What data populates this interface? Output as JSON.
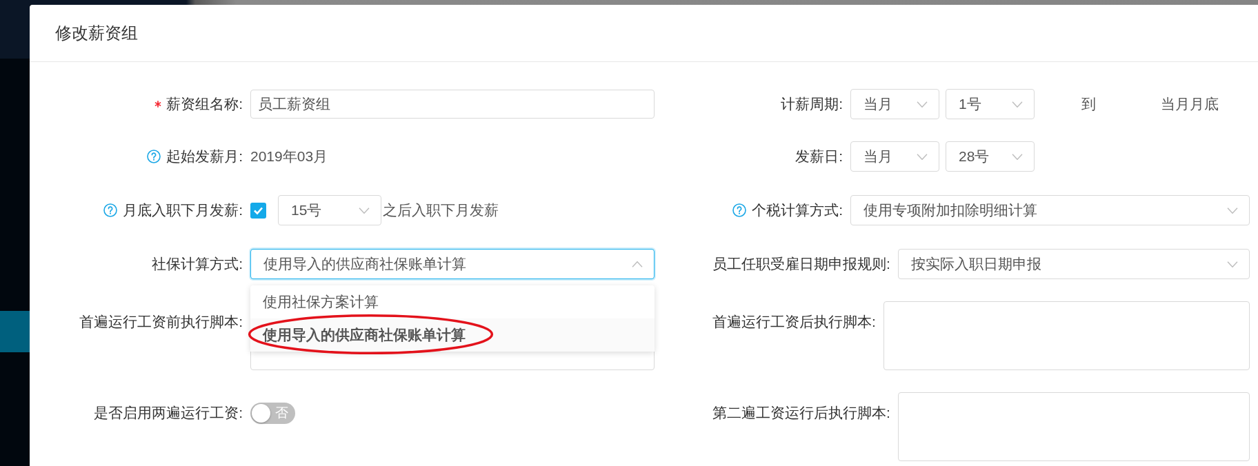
{
  "dialog": {
    "title": "修改薪资组"
  },
  "form": {
    "rows": [
      {
        "left": {
          "kind": "input",
          "label": "薪资组名称:",
          "required": true,
          "help": false,
          "value": "员工薪资组"
        },
        "right": {
          "kind": "select_group",
          "label": "计薪周期:",
          "required": false,
          "help": false,
          "selects": [
            {
              "value": "当月",
              "expanded": false
            },
            {
              "value": "1号",
              "expanded": false
            }
          ],
          "connector": "到",
          "end": "当月月底"
        }
      },
      {
        "left": {
          "kind": "static",
          "label": "起始发薪月:",
          "required": false,
          "help": true,
          "value": "2019年03月"
        },
        "right": {
          "kind": "select_group",
          "label": "发薪日:",
          "required": false,
          "help": false,
          "selects": [
            {
              "value": "当月",
              "expanded": false
            },
            {
              "value": "28号",
              "expanded": false
            }
          ]
        }
      },
      {
        "left": {
          "kind": "checkbox_select",
          "label": "月底入职下月发薪:",
          "required": false,
          "help": true,
          "checked": true,
          "select": {
            "value": "15号",
            "expanded": false
          },
          "suffix": "之后入职下月发薪"
        },
        "right": {
          "kind": "select",
          "label": "个税计算方式:",
          "required": false,
          "help": true,
          "value": "使用专项附加扣除明细计算",
          "expanded": false
        }
      },
      {
        "left": {
          "kind": "select",
          "label": "社保计算方式:",
          "required": false,
          "help": false,
          "value": "使用导入的供应商社保账单计算",
          "expanded": true,
          "options": [
            {
              "label": "使用社保方案计算",
              "selected": false,
              "circled": false
            },
            {
              "label": "使用导入的供应商社保账单计算",
              "selected": true,
              "circled": true
            }
          ]
        },
        "right": {
          "kind": "select",
          "label": "员工任职受雇日期申报规则:",
          "required": false,
          "help": false,
          "value": "按实际入职日期申报",
          "expanded": false
        }
      },
      {
        "left": {
          "kind": "textarea",
          "label": "首遍运行工资前执行脚本:",
          "required": false,
          "help": false
        },
        "right": {
          "kind": "textarea",
          "label": "首遍运行工资后执行脚本:",
          "required": false,
          "help": false
        }
      },
      {
        "left": {
          "kind": "switch",
          "label": "是否启用两遍运行工资:",
          "required": false,
          "help": false,
          "on": false,
          "text": "否"
        },
        "right": {
          "kind": "textarea",
          "label": "第二遍工资运行后执行脚本:",
          "required": false,
          "help": false
        }
      }
    ]
  }
}
